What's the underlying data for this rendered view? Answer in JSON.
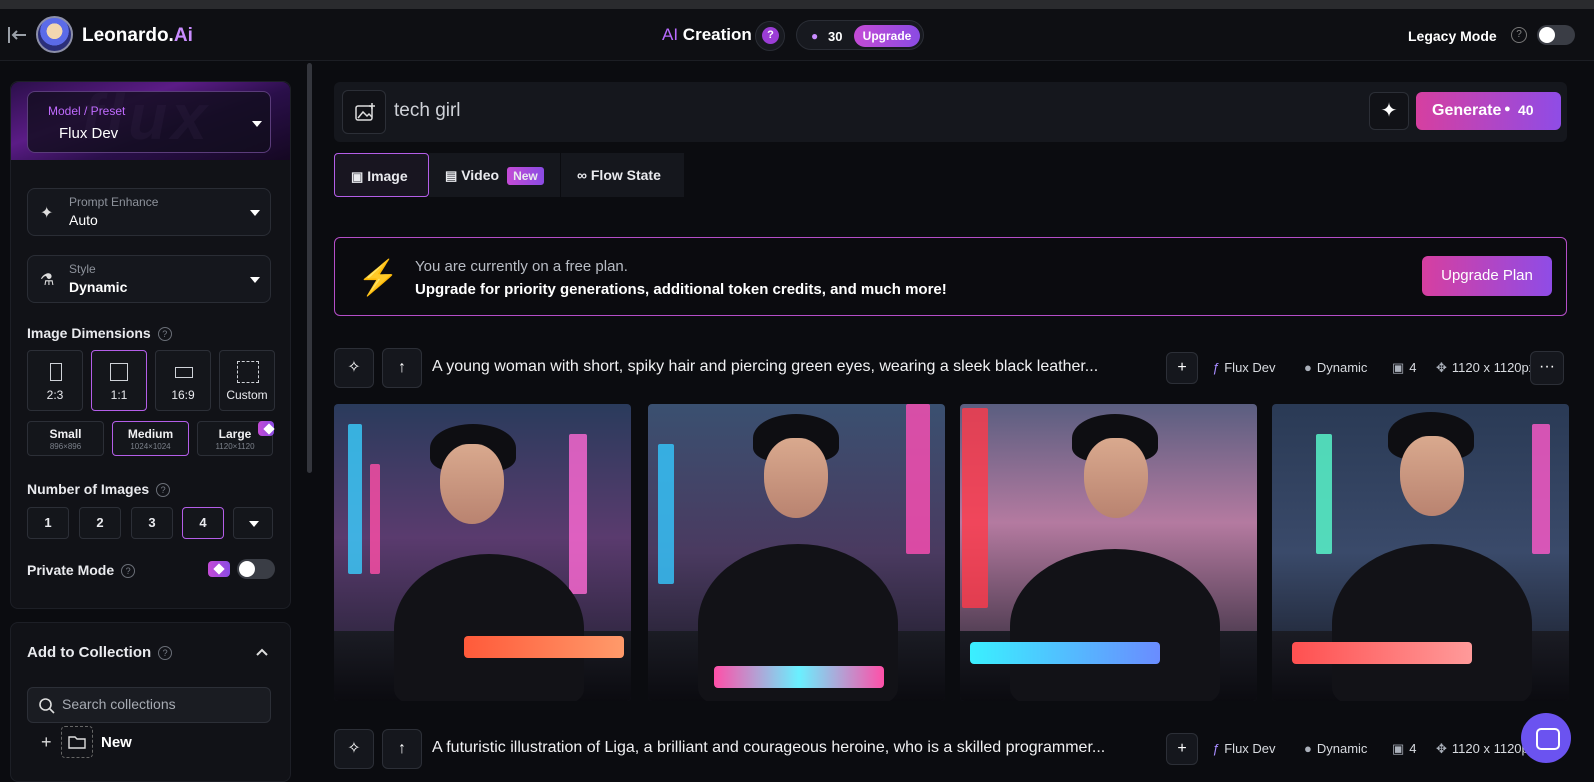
{
  "header": {
    "brand_main": "Leonardo.",
    "brand_ai": "Ai",
    "title_ai": "AI",
    "title_rest": "Creation",
    "help_label": "?",
    "tokens": "30",
    "upgrade_label": "Upgrade",
    "legacy_mode_label": "Legacy Mode",
    "legacy_mode_on": false
  },
  "sidebar": {
    "model": {
      "label": "Model / Preset",
      "value": "Flux Dev",
      "deco": "flux"
    },
    "prompt_enhance": {
      "label": "Prompt Enhance",
      "value": "Auto"
    },
    "style": {
      "label": "Style",
      "value": "Dynamic"
    },
    "image_dimensions": {
      "title": "Image Dimensions",
      "ratios": [
        {
          "label": "2:3",
          "selected": false
        },
        {
          "label": "1:1",
          "selected": true
        },
        {
          "label": "16:9",
          "selected": false
        },
        {
          "label": "Custom",
          "selected": false
        }
      ],
      "sizes": [
        {
          "label": "Small",
          "sub": "896×896",
          "selected": false
        },
        {
          "label": "Medium",
          "sub": "1024×1024",
          "selected": true
        },
        {
          "label": "Large",
          "sub": "1120×1120",
          "selected": false
        }
      ]
    },
    "number_of_images": {
      "title": "Number of Images",
      "options": [
        "1",
        "2",
        "3",
        "4"
      ],
      "selected": "4"
    },
    "private_mode": {
      "label": "Private Mode",
      "on": false
    }
  },
  "collection": {
    "title": "Add to Collection",
    "search_placeholder": "Search collections",
    "new_label": "New"
  },
  "prompt": {
    "value": "tech girl",
    "generate_label": "Generate",
    "generate_cost": "40"
  },
  "tabs": [
    {
      "label": "Image",
      "active": true
    },
    {
      "label": "Video",
      "badge": "New",
      "active": false
    },
    {
      "label": "Flow State",
      "active": false
    }
  ],
  "banner": {
    "line1": "You are currently on a free plan.",
    "line2": "Upgrade for priority generations, additional token credits, and much more!",
    "button": "Upgrade Plan"
  },
  "generations": [
    {
      "prompt": "A young woman with short, spiky hair and piercing green eyes, wearing a sleek black leather...",
      "model": "Flux Dev",
      "style": "Dynamic",
      "count": "4",
      "size": "1120 x 1120px"
    },
    {
      "prompt": "A futuristic illustration of Liga, a brilliant and courageous heroine, who is a skilled programmer...",
      "model": "Flux Dev",
      "style": "Dynamic",
      "count": "4",
      "size": "1120 x 1120px"
    }
  ],
  "colors": {
    "accent": "#b45ee8",
    "gradient_start": "#d63fa0",
    "gradient_end": "#8f4ce6",
    "background": "#0b0c10",
    "panel": "#111217"
  }
}
